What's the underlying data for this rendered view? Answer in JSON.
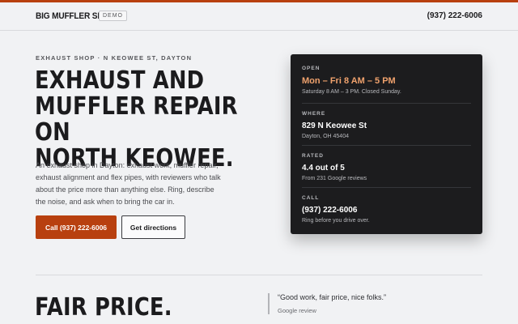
{
  "header": {
    "brand": "BIG MUFFLER SHOP",
    "badge": "DEMO",
    "phone": "(937) 222-6006"
  },
  "hero": {
    "eyebrow": "EXHAUST SHOP · N KEOWEE ST, DAYTON",
    "title_line1": "EXHAUST AND",
    "title_line2": "MUFFLER REPAIR ON",
    "title_line3": "NORTH KEOWEE.",
    "description": "An exhaust shop in Dayton: exhaust work, muffler repair, exhaust alignment and flex pipes, with reviewers who talk about the price more than anything else. Ring, describe the noise, and ask when to bring the car in.",
    "call_button": "Call (937) 222-6006",
    "directions_button": "Get directions"
  },
  "info_card": {
    "open": {
      "label": "OPEN",
      "value": "Mon – Fri 8 AM – 5 PM",
      "sub": "Saturday 8 AM – 3 PM. Closed Sunday."
    },
    "where": {
      "label": "WHERE",
      "value": "829 N Keowee St",
      "sub": "Dayton, OH 45404"
    },
    "rated": {
      "label": "RATED",
      "value": "4.4 out of 5",
      "sub": "From 231 Google reviews"
    },
    "call": {
      "label": "CALL",
      "value": "(937) 222-6006",
      "sub": "Ring before you drive over."
    }
  },
  "section": {
    "title": "FAIR PRICE.",
    "quote": "“Good work, fair price, nice folks.”",
    "quote_source": "Google review"
  },
  "colors": {
    "accent": "#b8400f",
    "accent_light": "#f0a26d",
    "card_bg": "#1c1c1e",
    "page_bg": "#f1f2f4"
  }
}
